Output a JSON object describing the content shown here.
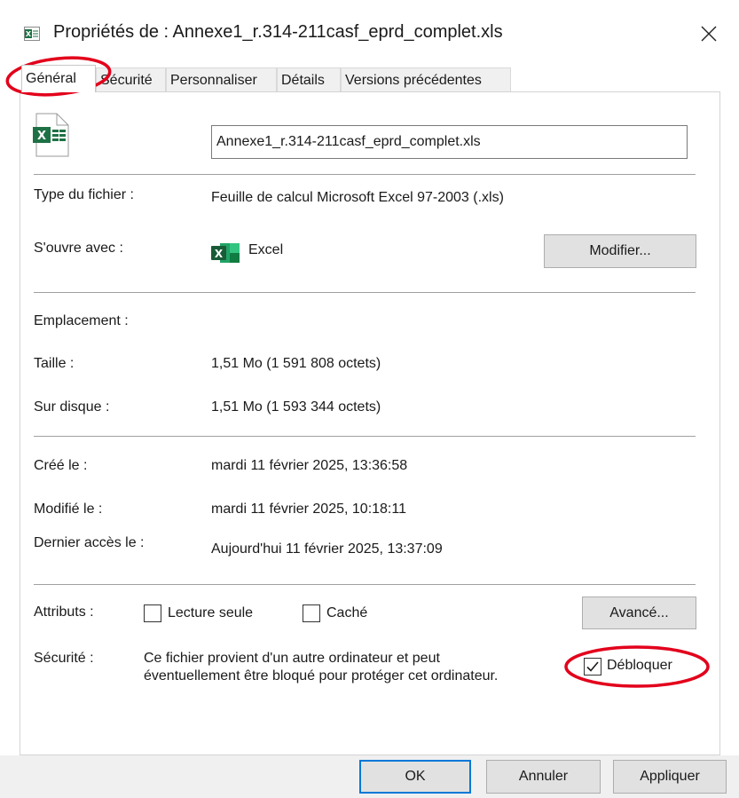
{
  "window": {
    "title": "Propriétés de : Annexe1_r.314-211casf_eprd_complet.xls"
  },
  "tabs": [
    {
      "label": "Général",
      "active": true
    },
    {
      "label": "Sécurité",
      "active": false
    },
    {
      "label": "Personnaliser",
      "active": false
    },
    {
      "label": "Détails",
      "active": false
    },
    {
      "label": "Versions précédentes",
      "active": false
    }
  ],
  "general": {
    "file_name": "Annexe1_r.314-211casf_eprd_complet.xls",
    "file_type_label": "Type du fichier :",
    "file_type_value": "Feuille de calcul Microsoft Excel 97-2003 (.xls)",
    "opens_with_label": "S'ouvre avec :",
    "opens_with_value": "Excel",
    "change_button": "Modifier...",
    "location_label": "Emplacement :",
    "size_label": "Taille :",
    "size_value": "1,51 Mo (1 591 808 octets)",
    "size_on_disk_label": "Sur disque :",
    "size_on_disk_value": "1,51 Mo (1 593 344 octets)",
    "created_label": "Créé le :",
    "created_value": "mardi 11 février 2025, 13:36:58",
    "modified_label": "Modifié le :",
    "modified_value": "mardi 11 février 2025, 10:18:11",
    "accessed_label": "Dernier accès le :",
    "accessed_value": "Aujourd'hui 11 février 2025, 13:37:09",
    "attributes_label": "Attributs :",
    "readonly_label": "Lecture seule",
    "readonly_checked": false,
    "hidden_label": "Caché",
    "hidden_checked": false,
    "advanced_button": "Avancé...",
    "security_label": "Sécurité :",
    "security_text_line1": "Ce fichier provient d'un autre ordinateur et peut",
    "security_text_line2": "éventuellement être bloqué pour protéger cet ordinateur.",
    "unblock_label": "Débloquer",
    "unblock_checked": true
  },
  "footer": {
    "ok_button": "OK",
    "cancel_button": "Annuler",
    "apply_button": "Appliquer"
  },
  "colors": {
    "accent": "#0078d7",
    "annotation": "#e3001b",
    "excel_green": "#1e7145"
  },
  "icons": {
    "title": "excel-file-icon",
    "close": "close-icon",
    "file": "excel-file-icon",
    "app": "excel-app-icon",
    "check": "checkmark-icon"
  }
}
